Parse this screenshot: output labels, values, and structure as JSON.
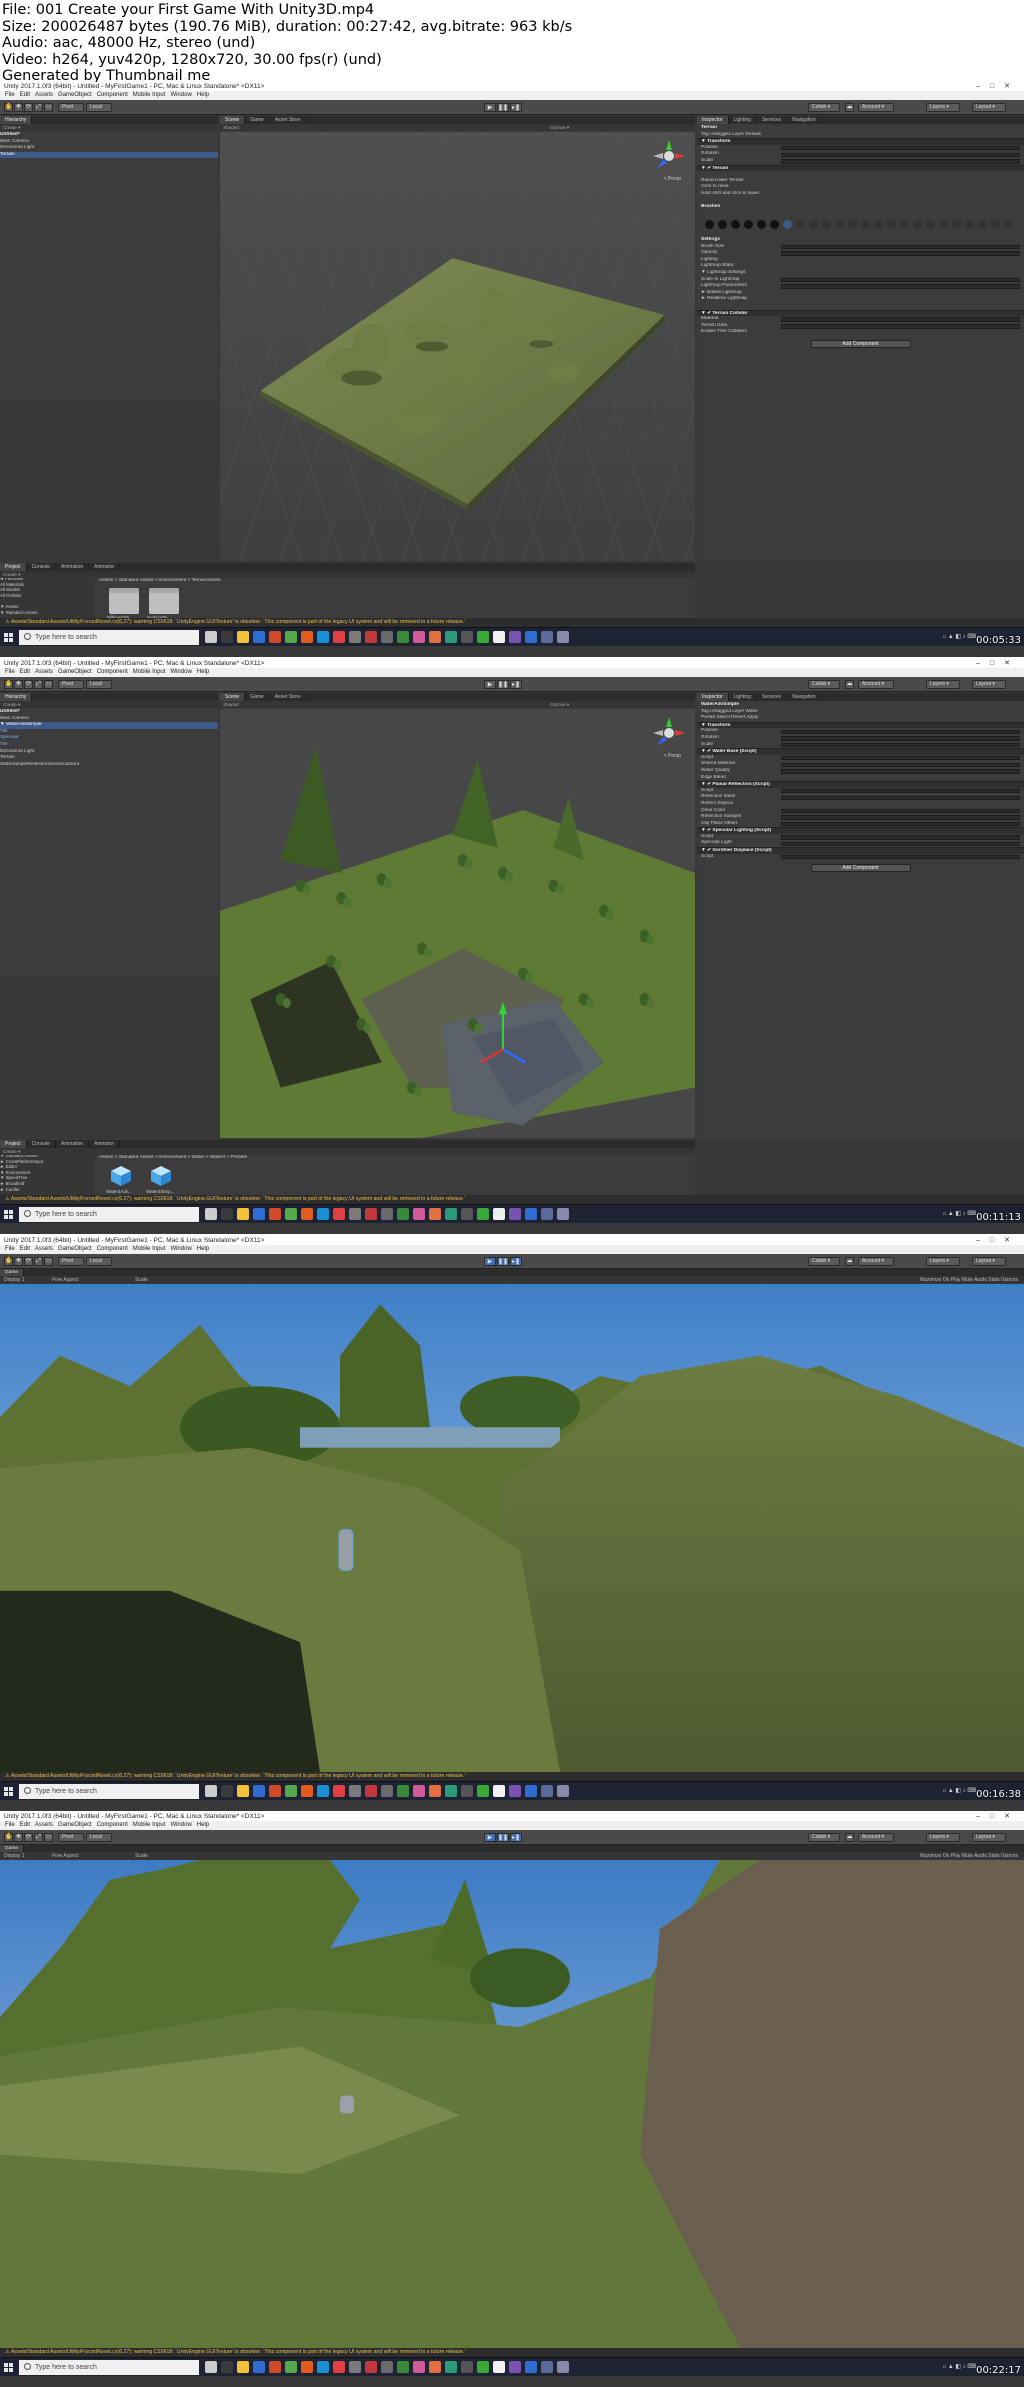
{
  "file_info": [
    "File: 001 Create your First Game With Unity3D.mp4",
    "Size: 200026487 bytes (190.76 MiB), duration: 00:27:42, avg.bitrate: 963 kb/s",
    "Audio: aac, 48000 Hz, stereo (und)",
    "Video: h264, yuv420p, 1280x720, 30.00 fps(r) (und)",
    "Generated by Thumbnail me"
  ],
  "frames": [
    {
      "window_title": "Unity 2017.1.0f3 (64bit) - Untitled - MyFirstGame1 - PC, Mac & Linux Standalone* <DX11>",
      "timestamp": "00:05:33",
      "hierarchy": {
        "items": [
          {
            "label": "Untitled*",
            "style": "hd"
          },
          {
            "label": "  Main Camera",
            "style": ""
          },
          {
            "label": "  Directional Light",
            "style": ""
          },
          {
            "label": "  Terrain",
            "style": "sel"
          }
        ]
      },
      "inspector": {
        "object_name": "Terrain",
        "rows": [
          {
            "label": "Terrain",
            "style": "hd"
          },
          {
            "label": "Tag  Untagged        Layer  Default",
            "style": ""
          },
          {
            "label": "▼ Transform",
            "style": "cmp"
          },
          {
            "label": "Position",
            "style": "v"
          },
          {
            "label": "Rotation",
            "style": "v"
          },
          {
            "label": "Scale",
            "style": "v"
          },
          {
            "label": "▼ ✔ Terrain",
            "style": "cmp"
          },
          {
            "label": "",
            "style": ""
          },
          {
            "label": "Raise/Lower Terrain",
            "style": ""
          },
          {
            "label": "Click to raise.",
            "style": ""
          },
          {
            "label": "Hold shift and click to lower.",
            "style": ""
          },
          {
            "label": "",
            "style": ""
          },
          {
            "label": "Brushes",
            "style": "hd"
          },
          {
            "label": "",
            "style": ""
          },
          {
            "label": "",
            "style": ""
          },
          {
            "label": "",
            "style": ""
          },
          {
            "label": "",
            "style": ""
          },
          {
            "label": "Settings",
            "style": "hd"
          },
          {
            "label": "Brush Size",
            "style": "v"
          },
          {
            "label": "Opacity",
            "style": "v"
          },
          {
            "label": "Lighting",
            "style": ""
          },
          {
            "label": "  Lightmap Static",
            "style": ""
          },
          {
            "label": "▼ Lightmap Settings",
            "style": ""
          },
          {
            "label": "  Scale In Lightmap",
            "style": "v"
          },
          {
            "label": "  Lightmap Parameters",
            "style": "v"
          },
          {
            "label": "► Baked Lightmap",
            "style": ""
          },
          {
            "label": "► Realtime Lightmap",
            "style": ""
          },
          {
            "label": "",
            "style": ""
          },
          {
            "label": "▼ ✔ Terrain Collider",
            "style": "cmp"
          },
          {
            "label": "Material",
            "style": "v"
          },
          {
            "label": "Terrain Data",
            "style": "v"
          },
          {
            "label": "Enable Tree Colliders",
            "style": ""
          }
        ],
        "add_component": "Add Component"
      },
      "project_breadcrumb": "Assets > Standard Assets > Environment > TerrainAssets",
      "project_tree": [
        "★ Favorites",
        "  All Materials",
        "  All Models",
        "  All Prefabs",
        "",
        "▼ Assets",
        "  ▼ Standard Assets",
        "    ► CrossPlatformInput",
        "    ► Editor",
        "    ▼ Environment",
        "      ► SpeedTree",
        "      ► TerrainAssets",
        "    ► Water",
        "    ► Water (Basic)",
        "    Utility"
      ],
      "assets": [
        "BillboardTe...",
        "SurfaceTe..."
      ],
      "console": "Assets/Standard Assets/Utility/ForcedReset.cs(6,27): warning CS0618: `UnityEngine.GUITexture' is obsolete: `This component is part of the legacy UI system and will be removed in a future release.'"
    },
    {
      "window_title": "Unity 2017.1.0f3 (64bit) - Untitled - MyFirstGame1 - PC, Mac & Linux Standalone* <DX11>",
      "timestamp": "00:11:13",
      "hierarchy": {
        "items": [
          {
            "label": "Untitled*",
            "style": "hd"
          },
          {
            "label": "  Main Camera",
            "style": ""
          },
          {
            "label": "▼ WaterAdvSimple",
            "style": "sel"
          },
          {
            "label": "    Tile",
            "style": "blue"
          },
          {
            "label": "    Specular",
            "style": "blue"
          },
          {
            "label": "    Tile",
            "style": "blue"
          },
          {
            "label": "  Directional Light",
            "style": ""
          },
          {
            "label": "  Terrain",
            "style": ""
          },
          {
            "label": "  WaterSimpleReflectionSceneCamera",
            "style": ""
          }
        ]
      },
      "inspector": {
        "object_name": "WaterAdvSimple",
        "rows": [
          {
            "label": "WaterAdvSimple",
            "style": "hd"
          },
          {
            "label": "Tag  Untagged        Layer  Water",
            "style": ""
          },
          {
            "label": "Prefab   Select   Revert   Apply",
            "style": ""
          },
          {
            "label": "▼ Transform",
            "style": "cmp"
          },
          {
            "label": "Position",
            "style": "v"
          },
          {
            "label": "Rotation",
            "style": "v"
          },
          {
            "label": "Scale",
            "style": "v"
          },
          {
            "label": "▼ ✔ Water Base (Script)",
            "style": "cmp"
          },
          {
            "label": "Script",
            "style": "v"
          },
          {
            "label": "Shared Material",
            "style": "v"
          },
          {
            "label": "Water Quality",
            "style": "v"
          },
          {
            "label": "Edge Blend",
            "style": ""
          },
          {
            "label": "▼ ✔ Planar Reflection (Script)",
            "style": "cmp"
          },
          {
            "label": "Script",
            "style": "v"
          },
          {
            "label": "Reflection Mask",
            "style": "v"
          },
          {
            "label": "Reflect Skybox",
            "style": ""
          },
          {
            "label": "Clear Color",
            "style": "v"
          },
          {
            "label": "Reflection Sampler",
            "style": "v"
          },
          {
            "label": "Clip Plane Offset",
            "style": "v"
          },
          {
            "label": "▼ ✔ Specular Lighting (Script)",
            "style": "cmp"
          },
          {
            "label": "Script",
            "style": "v"
          },
          {
            "label": "Specular Light",
            "style": "v"
          },
          {
            "label": "▼ ✔ Gerstner Displace (Script)",
            "style": "cmp"
          },
          {
            "label": "Script",
            "style": "v"
          }
        ],
        "add_component": "Add Component"
      },
      "project_breadcrumb": "Assets > Standard Assets > Environment > Water > Water4 > Prefabs",
      "project_tree": [
        "▼ Standard Assets",
        "  ► CrossPlatformInput",
        "  ► Editor",
        "  ▼ Environment",
        "    ▼ SpeedTree",
        "      ► Broadleaf",
        "      ► Conifer",
        "      ► Palm",
        "    ► TerrainAssets",
        "    ▼ Water",
        "      ► Water",
        "      ▼ Water4",
        "        Materials",
        "        Models",
        "        Prefabs"
      ],
      "assets": [
        "Water4Adv...",
        "Water4Simp..."
      ],
      "console": "Assets/Standard Assets/Utility/ForcedReset.cs(6,27): warning CS0618: `UnityEngine.GUITexture' is obsolete: `This component is part of the legacy UI system and will be removed in a future release.'"
    },
    {
      "window_title": "Unity 2017.1.0f3 (64bit) - Untitled - MyFirstGame1 - PC, Mac & Linux Standalone* <DX11>",
      "timestamp": "00:16:38",
      "game_bar": {
        "display": "Display 1",
        "aspect": "Free Aspect",
        "scale": "Scale",
        "right": "Maximize On Play   Mute Audio   Stats   Gizmos"
      },
      "console": "Assets/Standard Assets/Utility/ForcedReset.cs(6,27): warning CS0618: `UnityEngine.GUITexture' is obsolete: `This component is part of the legacy UI system and will be removed in a future release.'"
    },
    {
      "window_title": "Unity 2017.1.0f3 (64bit) - Untitled - MyFirstGame1 - PC, Mac & Linux Standalone* <DX11>",
      "timestamp": "00:22:17",
      "game_bar": {
        "display": "Display 1",
        "aspect": "Free Aspect",
        "scale": "Scale",
        "right": "Maximize On Play   Mute Audio   Stats   Gizmos"
      },
      "console": "Assets/Standard Assets/Utility/ForcedReset.cs(6,27): warning CS0618: `UnityEngine.GUITexture' is obsolete: `This component is part of the legacy UI system and will be removed in a future release.'"
    }
  ],
  "menu": [
    "File",
    "Edit",
    "Assets",
    "GameObject",
    "Component",
    "Mobile Input",
    "Window",
    "Help"
  ],
  "toolbar": {
    "pivot": "Pivot",
    "local": "Local",
    "collab": "Collab ▾",
    "account": "Account ▾",
    "layers": "Layers ▾",
    "layout": "Layout ▾"
  },
  "tabs": {
    "hierarchy": "Hierarchy",
    "scene": "Scene",
    "game": "Game",
    "asset_store": "Asset Store",
    "inspector": "Inspector",
    "lighting": "Lighting",
    "services": "Services",
    "navigation": "Navigation",
    "project": "Project",
    "console": "Console",
    "animation": "Animation",
    "animator": "Animator"
  },
  "scene_bar": {
    "shaded": "Shaded",
    "gizmos": "Gizmos ▾",
    "persp": "< Persp"
  },
  "create_label": "Create ▾",
  "taskbar": {
    "search_placeholder": "Type here to search"
  },
  "colors": {
    "unity_bg": "#383838",
    "console_warning": "#e6c24a",
    "selection": "#3d5a8a",
    "taskbar": "#1e2333"
  }
}
